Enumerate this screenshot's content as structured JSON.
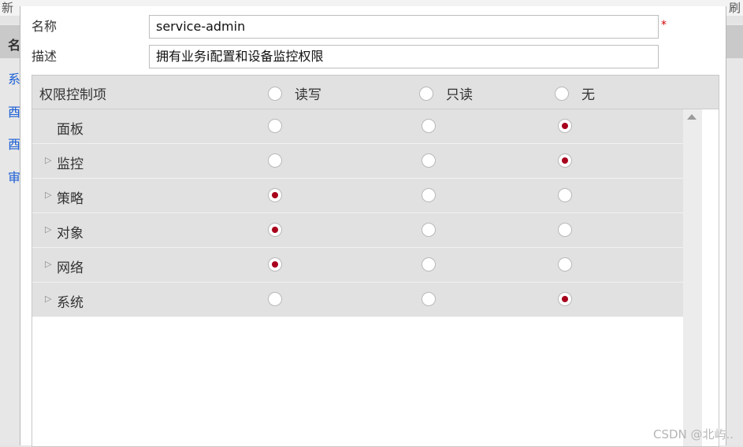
{
  "background": {
    "top_left_text": "新",
    "top_right_text": "刷",
    "header_left_text": "名",
    "left_links": [
      "系",
      "酉",
      "酉",
      "审"
    ]
  },
  "form": {
    "name_label": "名称",
    "name_value": "service-admin",
    "required_mark": "*",
    "desc_label": "描述",
    "desc_value": "拥有业务i配置和设备监控权限"
  },
  "permissions": {
    "header": {
      "title": "权限控制项",
      "options": [
        "读写",
        "只读",
        "无"
      ]
    },
    "rows": [
      {
        "label": "面板",
        "expandable": false,
        "selected": "无"
      },
      {
        "label": "监控",
        "expandable": true,
        "selected": "无"
      },
      {
        "label": "策略",
        "expandable": true,
        "selected": "读写"
      },
      {
        "label": "对象",
        "expandable": true,
        "selected": "读写"
      },
      {
        "label": "网络",
        "expandable": true,
        "selected": "读写"
      },
      {
        "label": "系统",
        "expandable": true,
        "selected": "无"
      }
    ]
  },
  "icons": {
    "expand": "expand-triangle-icon",
    "scroll_up": "scroll-up-arrow-icon"
  },
  "colors": {
    "selected_dot": "#a8001c",
    "required": "#d40000",
    "link": "#1a5ed6",
    "row_bg": "#e1e1e1"
  },
  "watermark": "CSDN @北屿.."
}
